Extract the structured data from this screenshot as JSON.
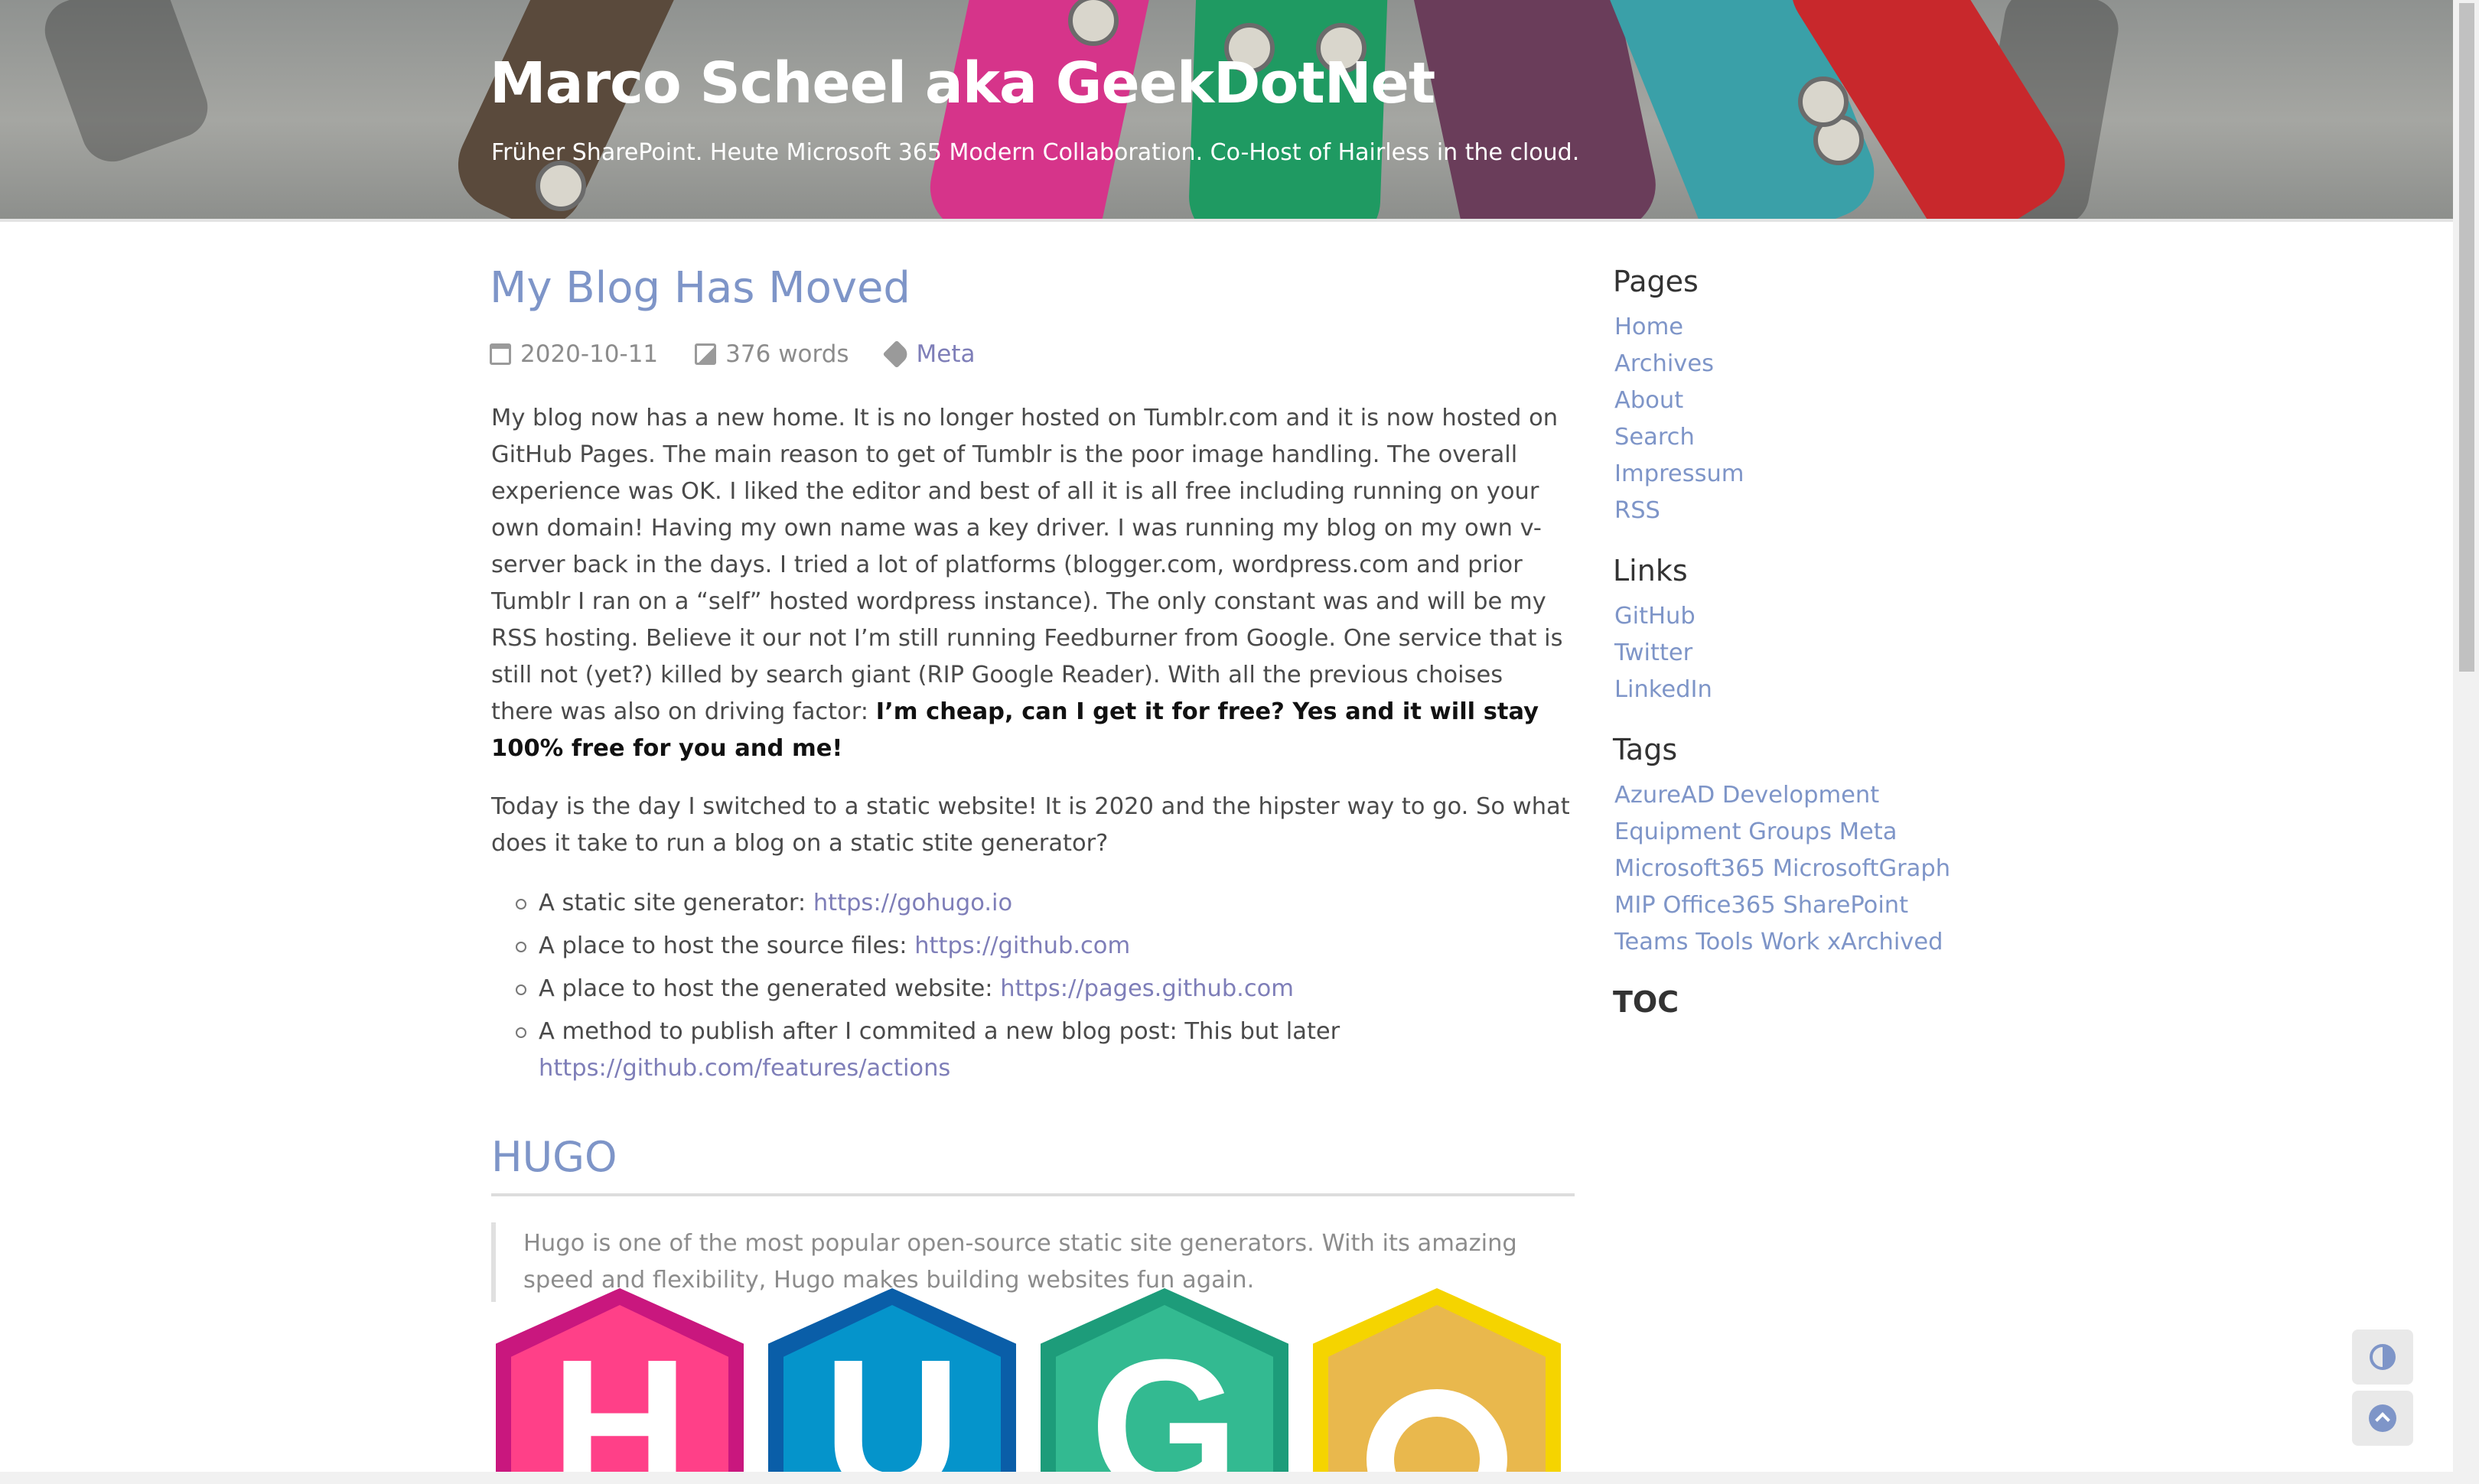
{
  "site": {
    "title": "Marco Scheel aka GeekDotNet",
    "subtitle": "Früher SharePoint. Heute Microsoft 365 Modern Collaboration. Co-Host of Hairless in the cloud."
  },
  "post": {
    "title": "My Blog Has Moved",
    "meta": {
      "date": "2020-10-11",
      "words": "376 words",
      "category": "Meta"
    },
    "p1": {
      "text": "My blog now has a new home. It is no longer hosted on Tumblr.com and it is now hosted on GitHub Pages. The main reason to get of Tumblr is the poor image handling. The overall experience was OK. I liked the editor and best of all it is all free including running on your own domain! Having my own name was a key driver. I was running my blog on my own v-server back in the days. I tried a lot of platforms (blogger.com, wordpress.com and prior Tumblr I ran on a “self” hosted wordpress instance). The only constant was and will be my RSS hosting. Believe it our not I’m still running Feedburner from Google. One service that is still not (yet?) killed by search giant (RIP Google Reader). With all the previous choises there was also on driving factor: ",
      "bold": "I’m cheap, can I get it for free? Yes and it will stay 100% free for you and me!"
    },
    "p2": "Today is the day I switched to a static website! It is 2020 and the hipster way to go. So what does it take to run a blog on a static stite generator?",
    "list": [
      {
        "text": "A static site generator: ",
        "link": "https://gohugo.io"
      },
      {
        "text": "A place to host the source files: ",
        "link": "https://github.com"
      },
      {
        "text": "A place to host the generated website: ",
        "link": "https://pages.github.com"
      },
      {
        "text": "A method to publish after I commited a new blog post: This but later ",
        "link": "https://github.com/features/actions"
      }
    ],
    "h2": "HUGO",
    "quote": "Hugo is one of the most popular open-source static site generators. With its amazing speed and flexibility, Hugo makes building websites fun again.",
    "logo_letters": [
      "H",
      "U",
      "G",
      "O"
    ],
    "logo_colors": {
      "h_outer": "#c9177e",
      "h_inner": "#ff4088",
      "u_outer": "#0a5ea8",
      "u_inner": "#0594cb",
      "g_outer": "#1d9c7a",
      "g_inner": "#33ba91",
      "o_outer": "#f5d400",
      "o_inner": "#e9b84d"
    }
  },
  "sidebar": {
    "pages_heading": "Pages",
    "pages": [
      "Home",
      "Archives",
      "About",
      "Search",
      "Impressum",
      "RSS"
    ],
    "links_heading": "Links",
    "links": [
      "GitHub",
      "Twitter",
      "LinkedIn"
    ],
    "tags_heading": "Tags",
    "tags": [
      "AzureAD Development",
      "Equipment Groups Meta",
      "Microsoft365 MicrosoftGraph",
      "MIP Office365 SharePoint",
      "Teams Tools Work xArchived"
    ],
    "toc_heading": "TOC"
  },
  "icons": {
    "date": "calendar-icon",
    "words": "image-icon",
    "category": "tag-icon",
    "theme": "theme-toggle-icon",
    "top": "arrow-up-icon"
  },
  "colors": {
    "link": "#7e95c8",
    "heading_link": "#7e95c8",
    "text": "#4a4a4a"
  }
}
